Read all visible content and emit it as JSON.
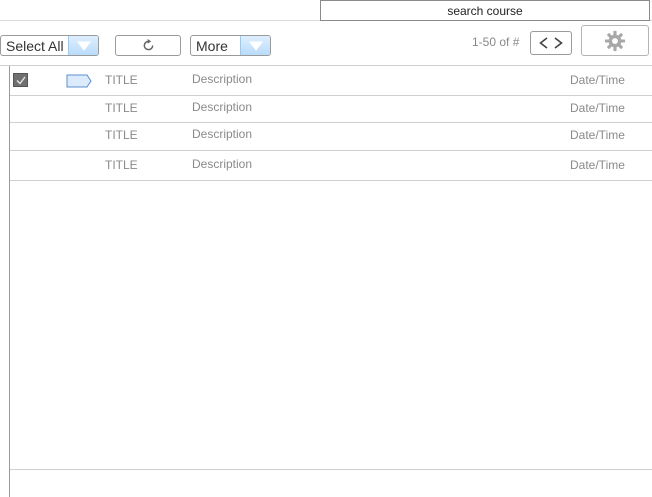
{
  "search": {
    "text": "search course"
  },
  "toolbar": {
    "select_all_label": "Select All",
    "more_label": "More",
    "pager_text": "1-50 of #"
  },
  "colors": {
    "accent": "#b9dcfb",
    "text_muted": "#8a8a8a",
    "border": "#9a9a9a"
  },
  "icons": {
    "refresh": "refresh-icon",
    "prev": "chevron-left-icon",
    "next": "chevron-right-icon",
    "settings": "gear-icon",
    "dropdown": "triangle-down-icon",
    "label_tag": "label-tag-icon",
    "check": "checkmark-icon"
  },
  "messages": [
    {
      "title": "TITLE",
      "description": "Description",
      "datetime": "Date/Time",
      "checked": true,
      "tagged": true
    },
    {
      "title": "TITLE",
      "description": "Description",
      "datetime": "Date/Time",
      "checked": false,
      "tagged": false
    },
    {
      "title": "TITLE",
      "description": "Description",
      "datetime": "Date/Time",
      "checked": false,
      "tagged": false
    },
    {
      "title": "TITLE",
      "description": "Description",
      "datetime": "Date/Time",
      "checked": false,
      "tagged": false
    }
  ]
}
